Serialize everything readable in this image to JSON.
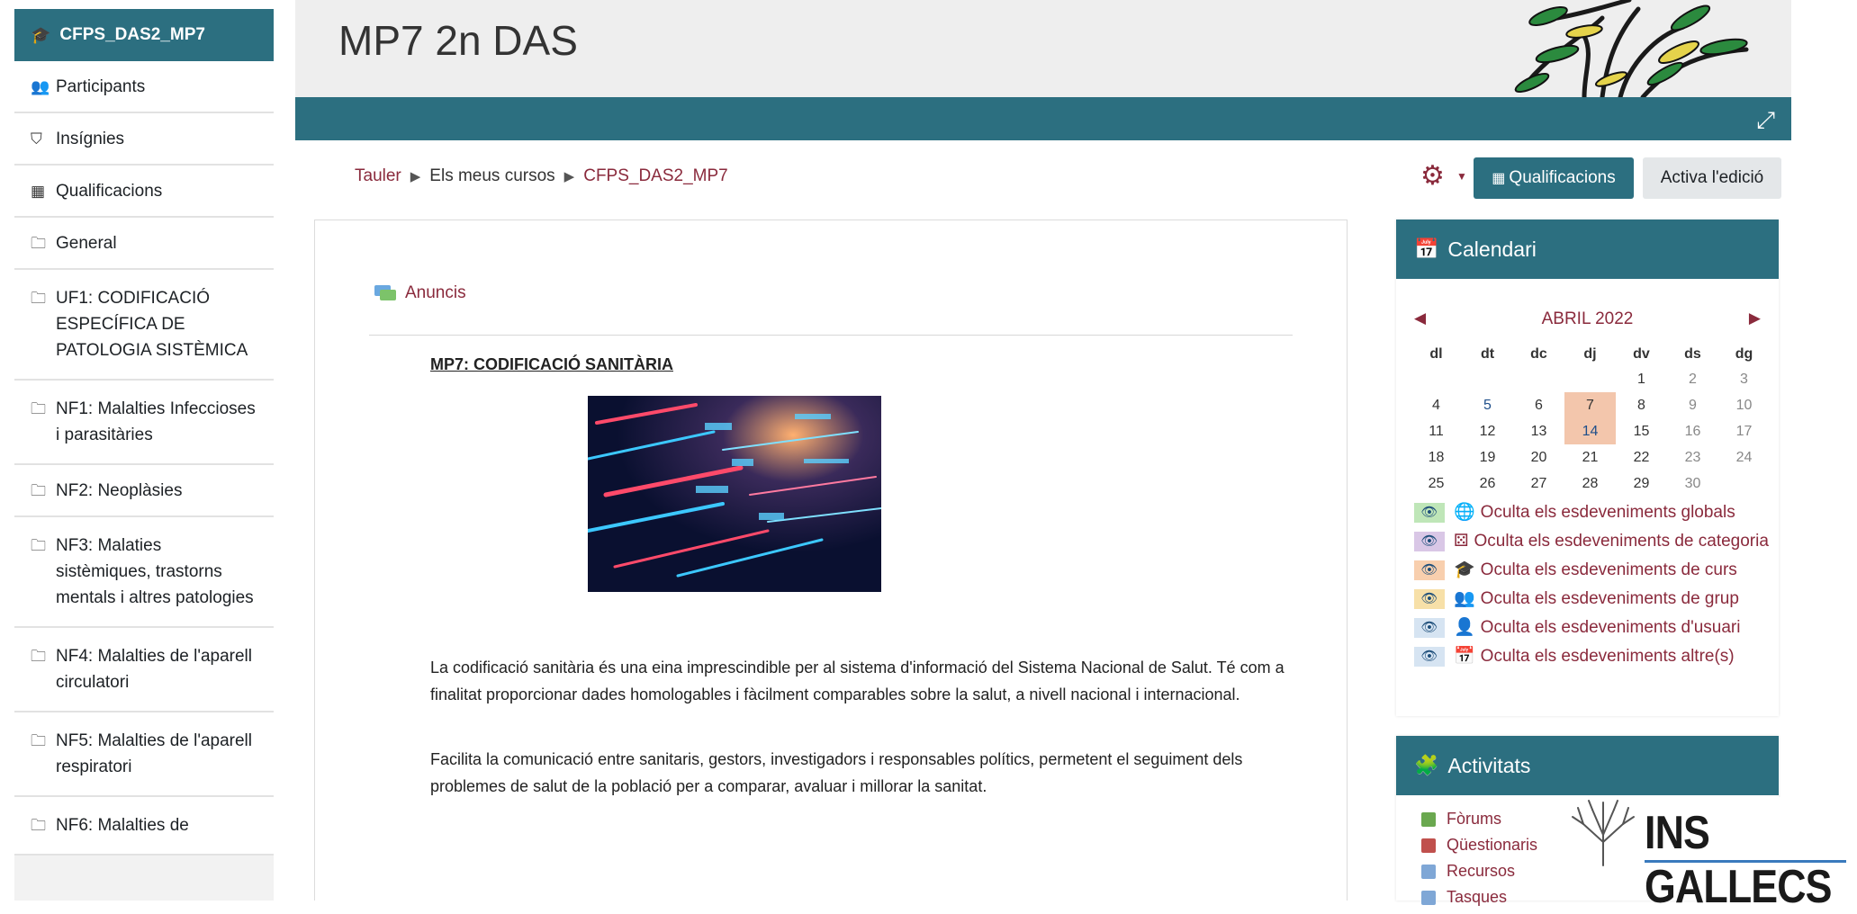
{
  "drawer": {
    "header": "CFPS_DAS2_MP7",
    "items": [
      {
        "label": "Participants",
        "icon": "users-icon"
      },
      {
        "label": "Insígnies",
        "icon": "shield-icon"
      },
      {
        "label": "Qualificacions",
        "icon": "table-icon"
      },
      {
        "label": "General",
        "icon": "folder-icon"
      },
      {
        "label": "UF1: CODIFICACIÓ ESPECÍFICA DE PATOLOGIA SISTÈMICA",
        "icon": "folder-icon"
      },
      {
        "label": "NF1: Malalties Infeccioses i parasitàries",
        "icon": "folder-icon"
      },
      {
        "label": "NF2: Neoplàsies",
        "icon": "folder-icon"
      },
      {
        "label": "NF3: Malaties sistèmiques, trastorns mentals i altres patologies",
        "icon": "folder-icon"
      },
      {
        "label": "NF4: Malalties de l'aparell circulatori",
        "icon": "folder-icon"
      },
      {
        "label": "NF5: Malalties de l'aparell respiratori",
        "icon": "folder-icon"
      },
      {
        "label": "NF6: Malalties de",
        "icon": "folder-icon"
      }
    ]
  },
  "header": {
    "title": "MP7 2n DAS"
  },
  "breadcrumb": {
    "home": "Tauler",
    "courses": "Els meus cursos",
    "current": "CFPS_DAS2_MP7"
  },
  "toolbar": {
    "grades_label": "Qualificacions",
    "edit_label": "Activa l'edició"
  },
  "main": {
    "forum_link": "Anuncis",
    "heading": "MP7: CODIFICACIÓ SANITÀRIA",
    "paragraph1": "La codificació sanitària és una eina imprescindible per al sistema d'informació del Sistema Nacional de Salut. Té com a finalitat proporcionar dades homologables i fàcilment comparables sobre la salut, a nivell nacional i internacional.",
    "paragraph2": "Facilita la comunicació entre sanitaris, gestors, investigadors i responsables polítics, permetent el seguiment dels problemes de salut de la població per a comparar, avaluar i millorar la sanitat."
  },
  "calendar": {
    "title": "Calendari",
    "month": "ABRIL 2022",
    "weekdays": [
      "dl",
      "dt",
      "dc",
      "dj",
      "dv",
      "ds",
      "dg"
    ],
    "weeks": [
      [
        "",
        "",
        "",
        "",
        "1",
        "2",
        "3"
      ],
      [
        "4",
        "5",
        "6",
        "7",
        "8",
        "9",
        "10"
      ],
      [
        "11",
        "12",
        "13",
        "14",
        "15",
        "16",
        "17"
      ],
      [
        "18",
        "19",
        "20",
        "21",
        "22",
        "23",
        "24"
      ],
      [
        "25",
        "26",
        "27",
        "28",
        "29",
        "30",
        ""
      ]
    ],
    "highlighted_days": [
      "7",
      "14"
    ],
    "linked_days": [
      "5",
      "14"
    ],
    "filters": [
      {
        "label": "Oculta els esdeveniments globals",
        "color": "#bfe6b8",
        "icon": "globe-icon"
      },
      {
        "label": "Oculta els esdeveniments de categoria",
        "color": "#d9c7e6",
        "icon": "cubes-icon"
      },
      {
        "label": "Oculta els esdeveniments de curs",
        "color": "#f8cfae",
        "icon": "graduation-cap-icon"
      },
      {
        "label": "Oculta els esdeveniments de grup",
        "color": "#f7e0a8",
        "icon": "users-icon"
      },
      {
        "label": "Oculta els esdeveniments d'usuari",
        "color": "#d6e4f2",
        "icon": "user-icon"
      },
      {
        "label": "Oculta els esdeveniments altre(s)",
        "color": "#d6e4f2",
        "icon": "calendar-icon"
      }
    ]
  },
  "activities": {
    "title": "Activitats",
    "items": [
      {
        "label": "Fòrums",
        "color": "#6aa84f"
      },
      {
        "label": "Qüestionaris",
        "color": "#c0504d"
      },
      {
        "label": "Recursos",
        "color": "#7fa7d6"
      },
      {
        "label": "Tasques",
        "color": "#7fa7d6"
      }
    ]
  },
  "logo": {
    "text": "INS GALLECS"
  }
}
